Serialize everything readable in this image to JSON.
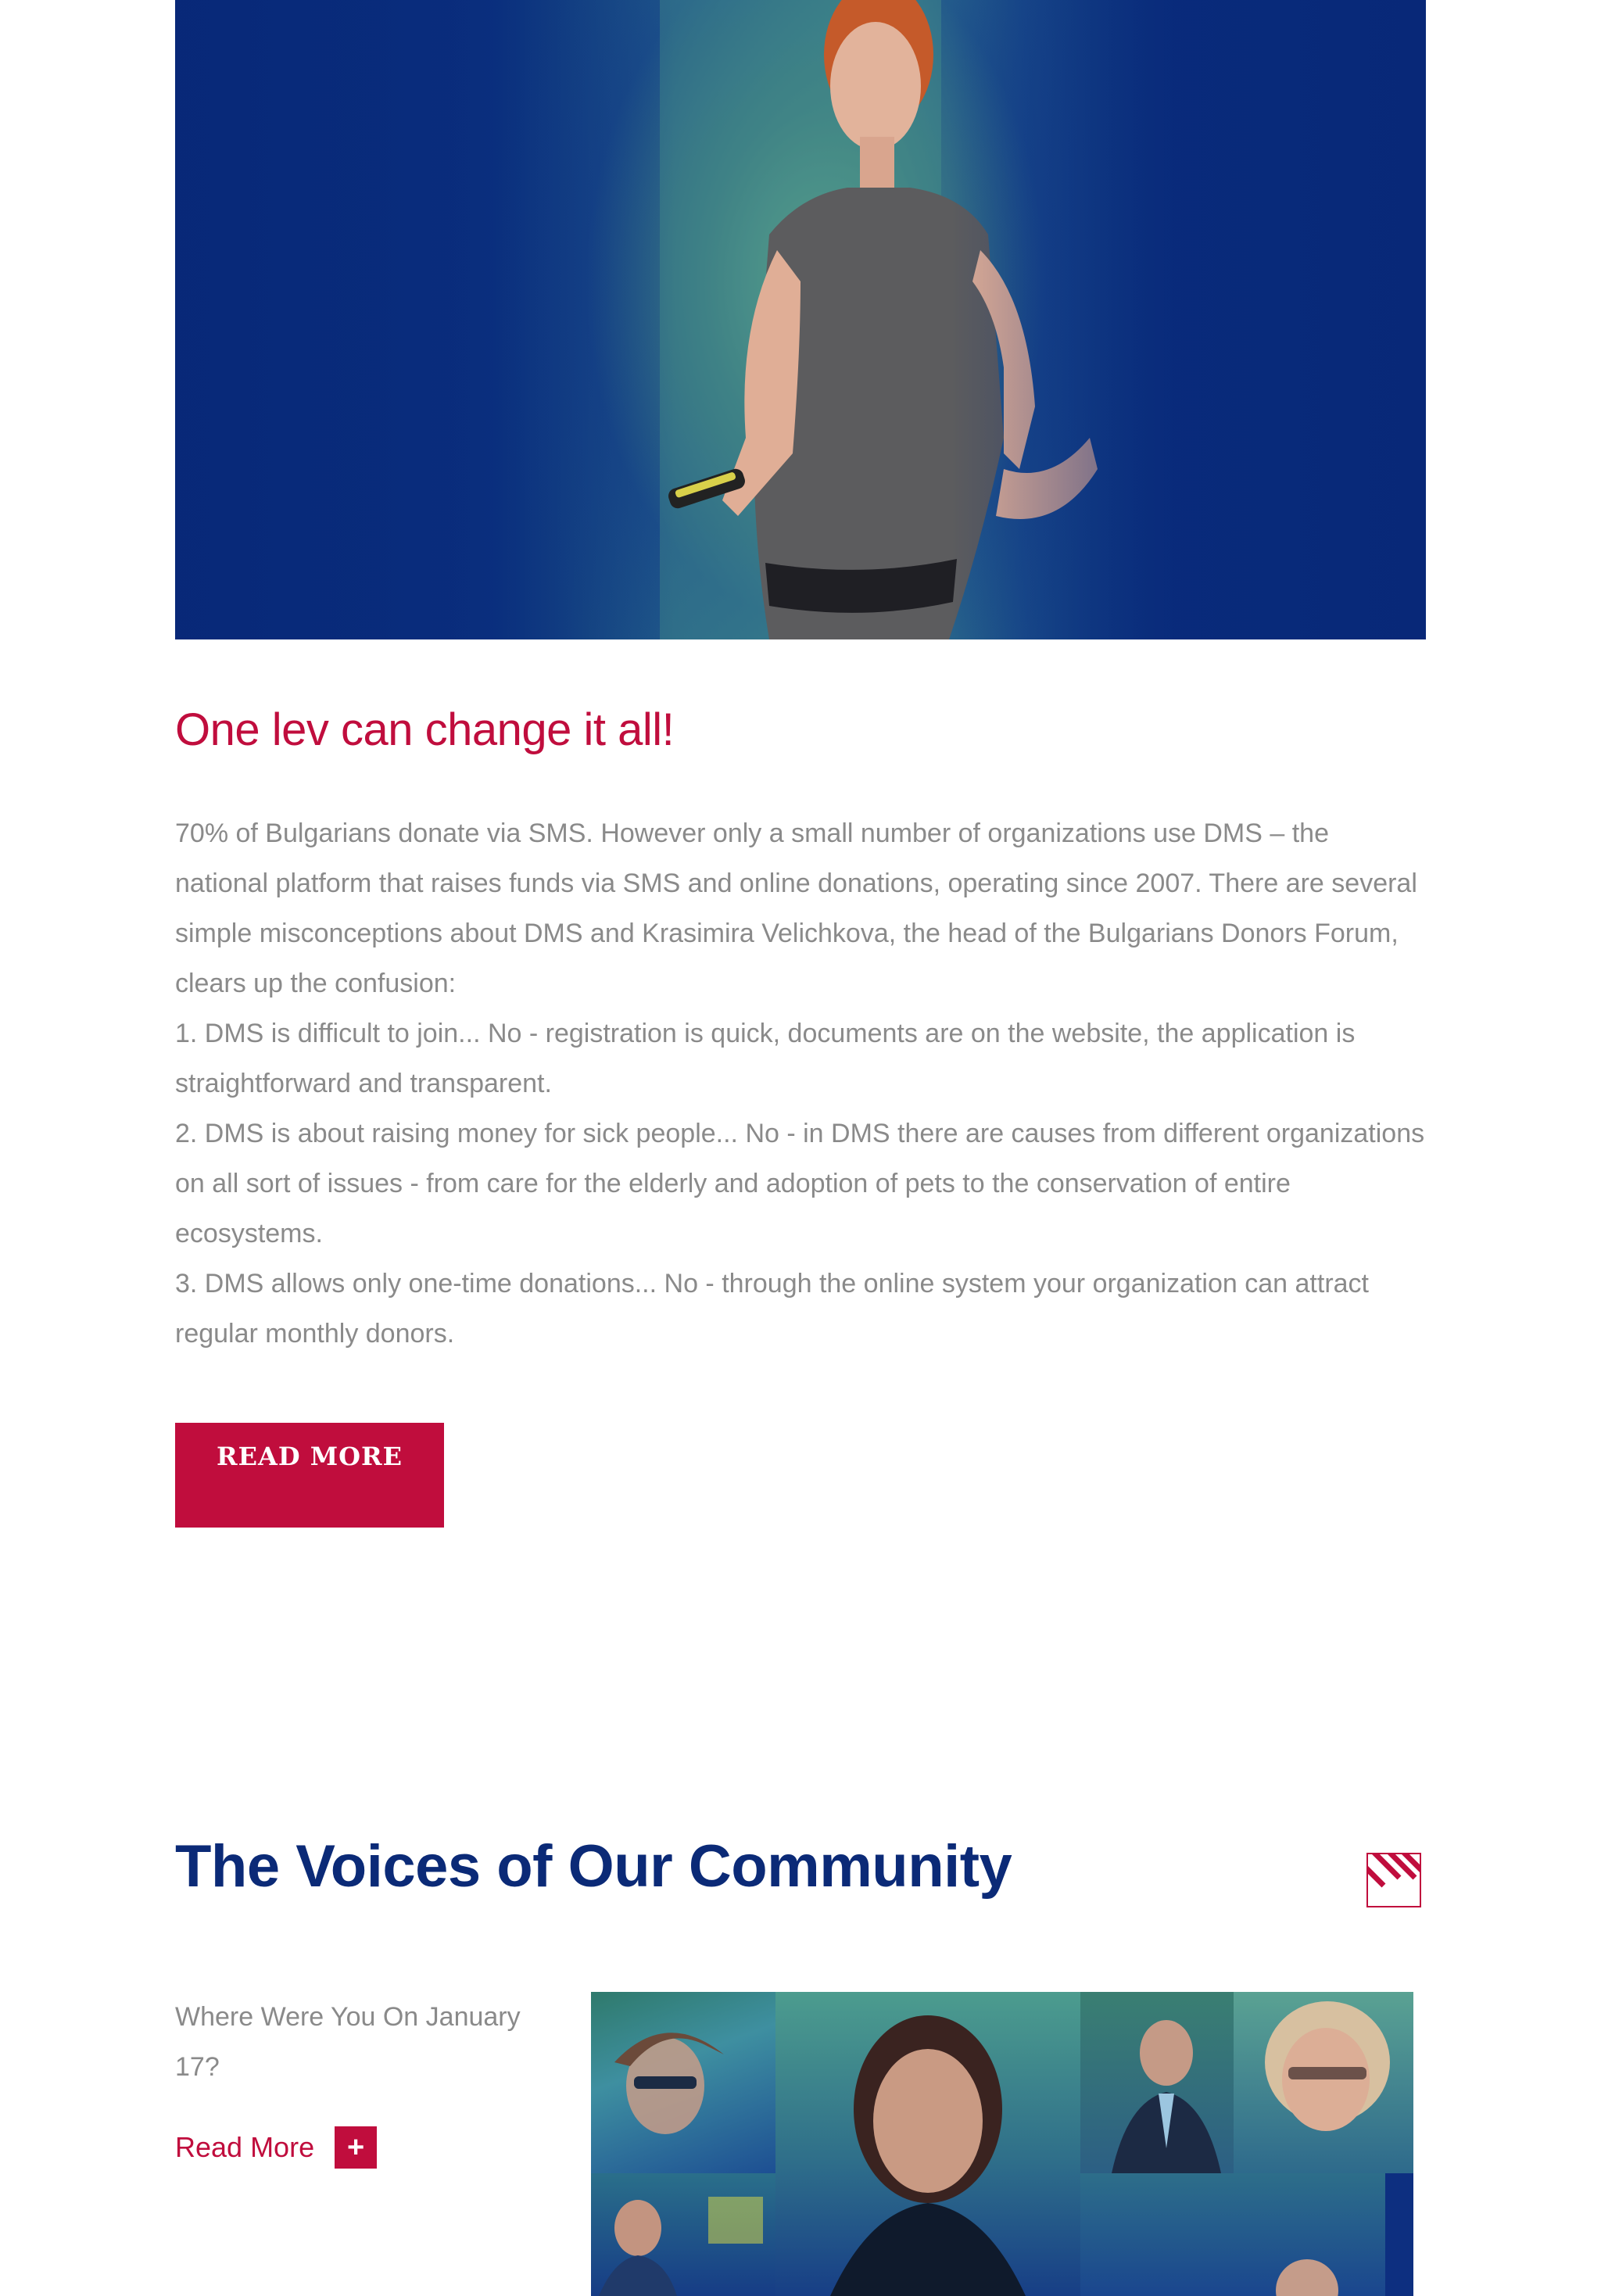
{
  "hero": {
    "image_alt": "Woman presenting on stage"
  },
  "article": {
    "title": "One lev can change it all!",
    "paragraphs": [
      "70% of Bulgarians donate via SMS. However only a small number of organizations use DMS – the national platform that raises funds via SMS and online donations, operating since 2007. There are several simple misconceptions about DMS and Krasimira Velichkova, the head of the Bulgarians Donors Forum, clears up the confusion:",
      "1. DMS is difficult to join... No - registration is quick, documents are on the website, the application is straightforward and transparent.",
      "2. DMS is about raising money for sick people... No - in DMS there are causes from different organizations on all sort of issues - from care for the elderly and adoption of pets to the conservation of entire ecosystems.",
      "3. DMS allows only one-time donations... No - through the online system your organization can attract regular monthly donors."
    ],
    "read_more_label": "READ MORE"
  },
  "community": {
    "title": "The Voices of Our Community",
    "icon": "diagonal-stripes-icon",
    "item": {
      "text": "Where Were You On January 17?",
      "link_label": "Read More",
      "link_icon": "+"
    }
  },
  "colors": {
    "accent": "#c00d3d",
    "navy": "#0b2a77",
    "body_text": "#8a8a8a"
  }
}
